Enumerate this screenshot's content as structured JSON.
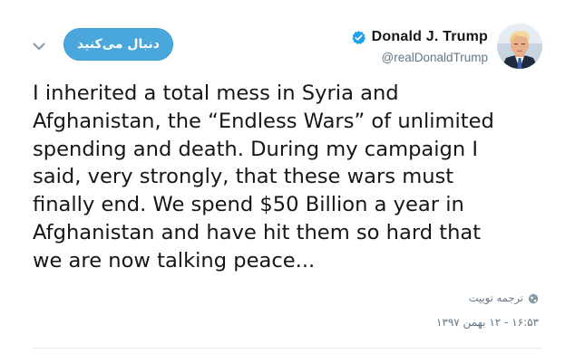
{
  "colors": {
    "follow_bg": "#4aa7db",
    "verified": "#1da1f2",
    "muted": "#657786",
    "text": "#14171a"
  },
  "header": {
    "follow_label": "دنبال می‌کنید",
    "display_name": "Donald J. Trump",
    "handle": "@realDonaldTrump",
    "verified_icon": "verified-badge-icon",
    "menu_icon": "chevron-down-icon"
  },
  "tweet": {
    "text": "I inherited a total mess in Syria and\nAfghanistan, the “Endless Wars” of unlimited\nspending and death. During my campaign I\nsaid, very strongly, that these wars must\nfinally end. We spend $50 Billion a year in\nAfghanistan and have hit them so hard that\nwe are now talking peace...",
    "translate_label": "ترجمه توییت",
    "translate_icon": "globe-icon",
    "timestamp": "۱۶:۵۳ - ۱۲ بهمن ۱۳۹۷"
  }
}
